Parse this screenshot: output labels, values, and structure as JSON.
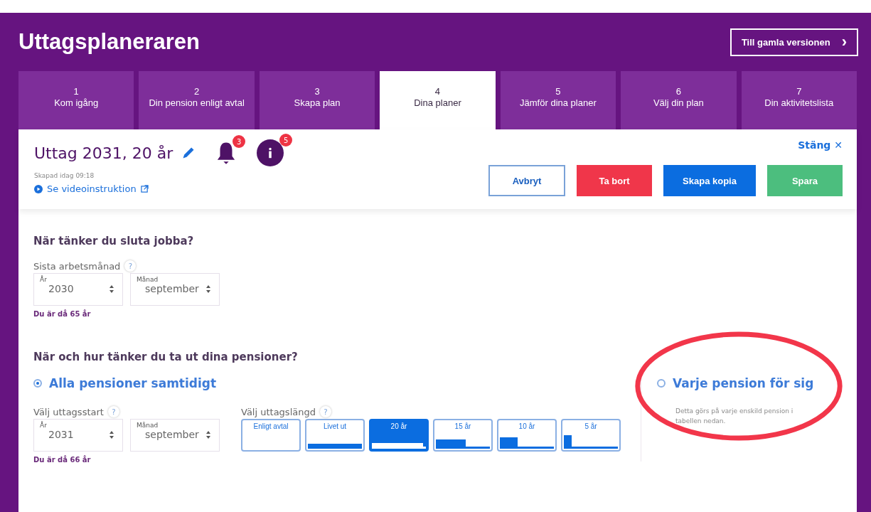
{
  "app_title": "Uttagsplaneraren",
  "old_version_button": {
    "label": "Till gamla versionen",
    "icon": "›"
  },
  "tabs": [
    {
      "number": "1",
      "label": "Kom igång",
      "selected": false
    },
    {
      "number": "2",
      "label": "Din pension enligt avtal",
      "selected": false
    },
    {
      "number": "3",
      "label": "Skapa plan",
      "selected": false
    },
    {
      "number": "4",
      "label": "Dina planer",
      "selected": true
    },
    {
      "number": "5",
      "label": "Jämför dina planer",
      "selected": false
    },
    {
      "number": "6",
      "label": "Välj din plan",
      "selected": false
    },
    {
      "number": "7",
      "label": "Din aktivitetslista",
      "selected": false
    }
  ],
  "plan": {
    "title": "Uttag 2031, 20 år",
    "created": "Skapad idag 09:18",
    "video_link": "Se videoinstruktion",
    "notifications_badge": "3",
    "info_badge": "5",
    "close_link": "Stäng ✕"
  },
  "actions": [
    {
      "label": "Avbryt",
      "kind": "outline"
    },
    {
      "label": "Ta bort",
      "kind": "danger"
    },
    {
      "label": "Skapa kopia",
      "kind": "primary"
    },
    {
      "label": "Spara",
      "kind": "success"
    }
  ],
  "stop_working": {
    "heading": "När tänker du sluta jobba?",
    "label": "Sista arbetsmånad",
    "help": "?",
    "year": {
      "label": "År",
      "value": "2030"
    },
    "month": {
      "label": "Månad",
      "value": "september"
    },
    "age_note": "Du är då 65 år"
  },
  "withdrawal": {
    "heading": "När och hur tänker du ta ut dina pensioner?",
    "modes": [
      {
        "label": "Alla pensioner samtidigt",
        "selected": true
      },
      {
        "label": "Varje pension för sig",
        "selected": false,
        "note": "Detta görs på varje enskild pension i tabellen nedan."
      }
    ],
    "start_label": "Välj uttagsstart",
    "start_help": "?",
    "year": {
      "label": "År",
      "value": "2031"
    },
    "month": {
      "label": "Månad",
      "value": "september"
    },
    "age_note": "Du är då 66 år",
    "length_label": "Välj uttagslängd",
    "length_help": "?",
    "lengths": [
      {
        "label": "Enligt avtal",
        "selected": false
      },
      {
        "label": "Livet ut",
        "selected": false,
        "level": 1
      },
      {
        "label": "20 år",
        "selected": true,
        "level": 0.95
      },
      {
        "label": "15 år",
        "selected": false,
        "level": 0.55
      },
      {
        "label": "10 år",
        "selected": false,
        "level": 0.33
      },
      {
        "label": "5 år",
        "selected": false,
        "level": 0.15
      }
    ]
  }
}
